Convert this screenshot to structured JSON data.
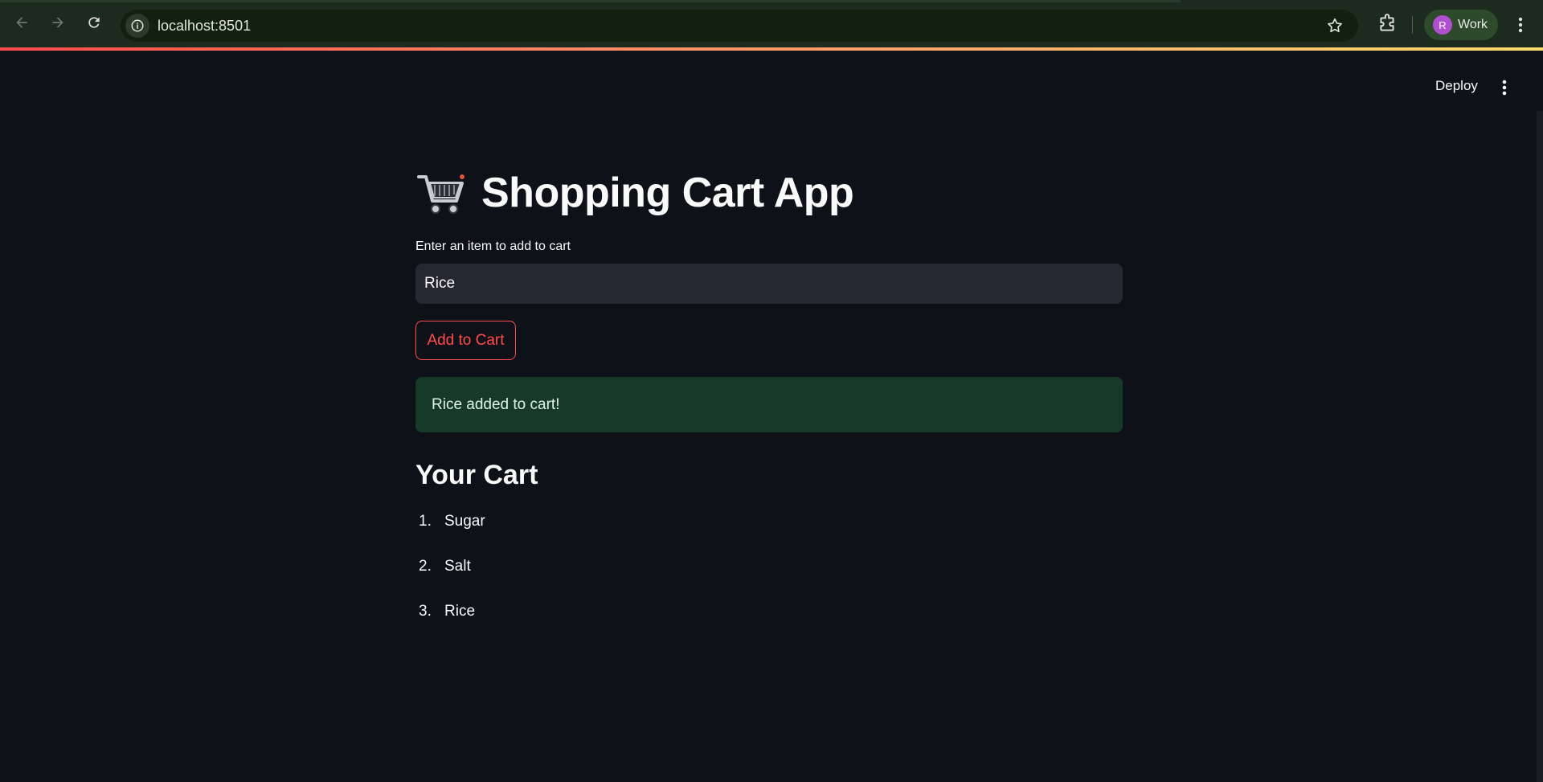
{
  "browser": {
    "url": "localhost:8501",
    "profile_initial": "R",
    "profile_label": "Work"
  },
  "app": {
    "deploy_label": "Deploy",
    "title_emoji": "cart-emoji",
    "title": "Shopping Cart App",
    "input_label": "Enter an item to add to cart",
    "input_value": "Rice",
    "add_button_label": "Add to Cart",
    "success_message": "Rice added to cart!",
    "cart_heading": "Your Cart",
    "cart_items": [
      {
        "number": "1.",
        "name": "Sugar"
      },
      {
        "number": "2.",
        "name": "Salt"
      },
      {
        "number": "3.",
        "name": "Rice"
      }
    ]
  },
  "colors": {
    "background": "#0e1117",
    "accent": "#ff4b4b",
    "success_bg": "#173928",
    "input_bg": "#262730",
    "chrome_bg": "#1d2a1e"
  }
}
